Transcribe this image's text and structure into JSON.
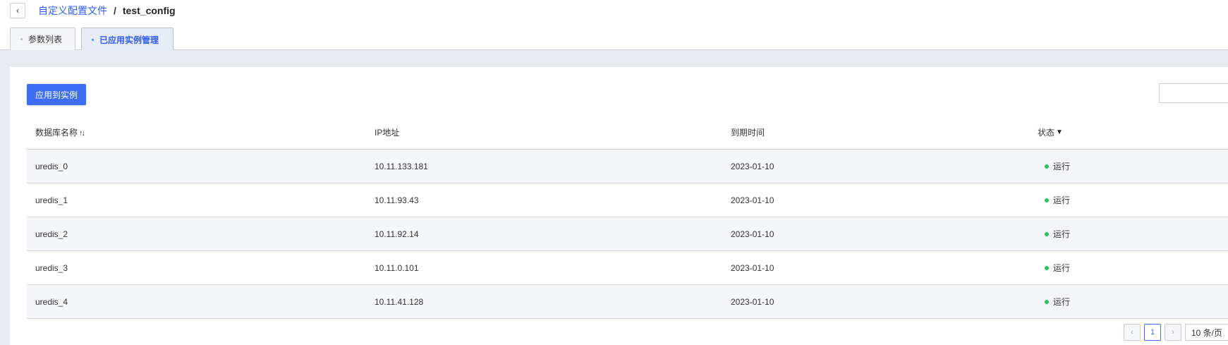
{
  "breadcrumb": {
    "back_icon": "chevron-left-icon",
    "parent": "自定义配置文件",
    "separator": "/",
    "current": "test_config"
  },
  "tabs": [
    {
      "label": "参数列表",
      "active": false
    },
    {
      "label": "已应用实例管理",
      "active": true
    }
  ],
  "toolbar": {
    "apply_label": "应用到实例",
    "search_placeholder": ""
  },
  "table": {
    "columns": [
      "数据库名称",
      "IP地址",
      "到期时间",
      "状态"
    ],
    "sort_icon": "sort-icon",
    "filter_icon": "filter-icon",
    "rows": [
      {
        "name": "uredis_0",
        "ip": "10.11.133.181",
        "expire": "2023-01-10",
        "status": "运行"
      },
      {
        "name": "uredis_1",
        "ip": "10.11.93.43",
        "expire": "2023-01-10",
        "status": "运行"
      },
      {
        "name": "uredis_2",
        "ip": "10.11.92.14",
        "expire": "2023-01-10",
        "status": "运行"
      },
      {
        "name": "uredis_3",
        "ip": "10.11.0.101",
        "expire": "2023-01-10",
        "status": "运行"
      },
      {
        "name": "uredis_4",
        "ip": "10.11.41.128",
        "expire": "2023-01-10",
        "status": "运行"
      }
    ]
  },
  "pagination": {
    "prev_icon": "chevron-left-icon",
    "current_page": "1",
    "next_icon": "chevron-right-icon",
    "page_size": "10 条/页"
  },
  "colors": {
    "accent": "#3d6df5",
    "link": "#2e5cf6",
    "status_running": "#2bc35a"
  }
}
